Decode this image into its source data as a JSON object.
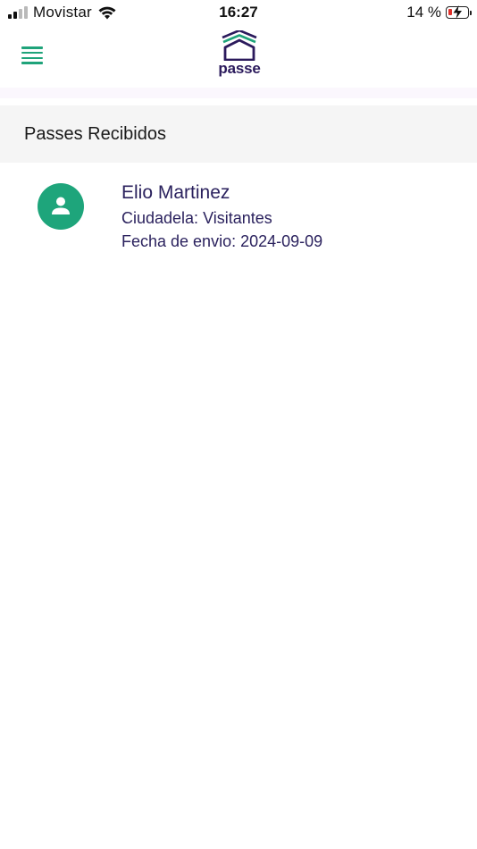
{
  "status_bar": {
    "carrier": "Movistar",
    "time": "16:27",
    "battery": "14 %",
    "signal_bars_active": 2,
    "signal_bars_total": 4,
    "battery_level": 0.14,
    "icons": [
      "signal-icon",
      "wifi-icon",
      "battery-charging-icon"
    ]
  },
  "header": {
    "logo_text": "passe",
    "menu_icon": "hamburger-menu-icon",
    "brand_colors": {
      "primary": "#2b1a5c",
      "accent": "#1fa37a"
    }
  },
  "section": {
    "title": "Passes Recibidos"
  },
  "passes": [
    {
      "name": "Elio Martinez",
      "ciudadela": "Ciudadela: Visitantes",
      "fecha": "Fecha de envio: 2024-09-09",
      "avatar_icon": "person-icon",
      "avatar_color": "#1ea57b"
    }
  ]
}
